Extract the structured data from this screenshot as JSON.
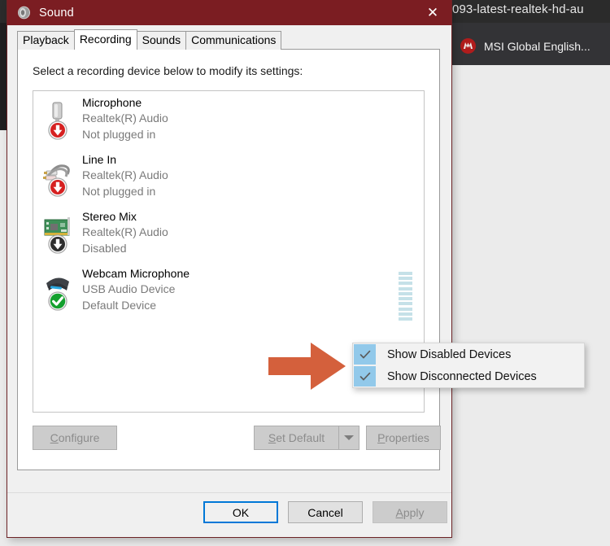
{
  "background": {
    "browser_tab_title": "093-latest-realtek-hd-au",
    "bookmark_label": "MSI Global English...",
    "msi_logo_name": "msi-dragon-logo"
  },
  "window": {
    "title": "Sound",
    "title_icon": "speaker-icon",
    "close_label": "✕",
    "titlebar_color": "#7b1d22"
  },
  "tabs": [
    {
      "label": "Playback",
      "active": false
    },
    {
      "label": "Recording",
      "active": true
    },
    {
      "label": "Sounds",
      "active": false
    },
    {
      "label": "Communications",
      "active": false
    }
  ],
  "page": {
    "instruction": "Select a recording device below to modify its settings:"
  },
  "devices": [
    {
      "name": "Microphone",
      "driver": "Realtek(R) Audio",
      "status": "Not plugged in",
      "icon": "microphone-icon",
      "badge": "red-down-arrow-badge",
      "meter": false
    },
    {
      "name": "Line In",
      "driver": "Realtek(R) Audio",
      "status": "Not plugged in",
      "icon": "rca-cable-icon",
      "badge": "red-down-arrow-badge",
      "meter": false
    },
    {
      "name": "Stereo Mix",
      "driver": "Realtek(R) Audio",
      "status": "Disabled",
      "icon": "sound-card-icon",
      "badge": "gray-down-arrow-badge",
      "meter": false
    },
    {
      "name": "Webcam Microphone",
      "driver": "USB Audio Device",
      "status": "Default Device",
      "icon": "webcam-icon",
      "badge": "green-check-badge",
      "meter": true
    }
  ],
  "meter": {
    "segments": 10,
    "color": "#c5e1e8"
  },
  "buttons": {
    "configure": {
      "accel": "C",
      "rest": "onfigure",
      "enabled": false
    },
    "set_default": {
      "accel": "S",
      "rest": "et Default",
      "enabled": false
    },
    "set_default_arrow_icon": "chevron-down-icon",
    "properties": {
      "accel": "P",
      "rest": "roperties",
      "enabled": false
    },
    "ok": "OK",
    "cancel": "Cancel",
    "apply": {
      "accel": "A",
      "rest": "pply",
      "enabled": false
    }
  },
  "context_menu": {
    "items": [
      {
        "label": "Show Disabled Devices",
        "checked": true
      },
      {
        "label": "Show Disconnected Devices",
        "checked": true
      }
    ],
    "check_bg": "#92c9ea"
  },
  "annotation": {
    "arrow_icon": "right-arrow-annotation",
    "color": "#d4603c"
  }
}
